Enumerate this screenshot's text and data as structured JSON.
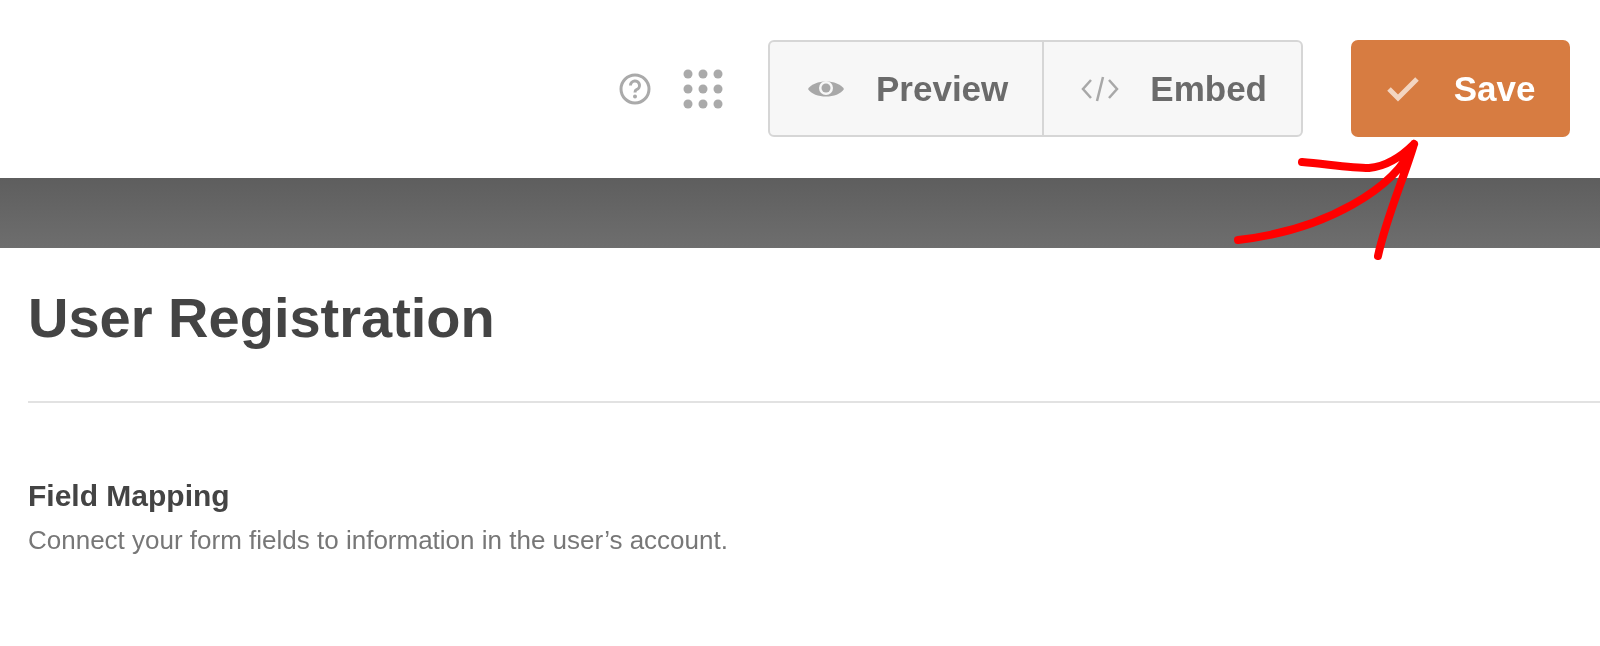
{
  "toolbar": {
    "buttons": [
      {
        "kind": "preview",
        "label": "Preview"
      },
      {
        "kind": "embed",
        "label": "Embed"
      }
    ],
    "save_button": {
      "label": "Save"
    }
  },
  "page": {
    "title": "User Registration",
    "section": {
      "title": "Field Mapping",
      "description": "Connect your form fields to information in the user’s account."
    }
  }
}
